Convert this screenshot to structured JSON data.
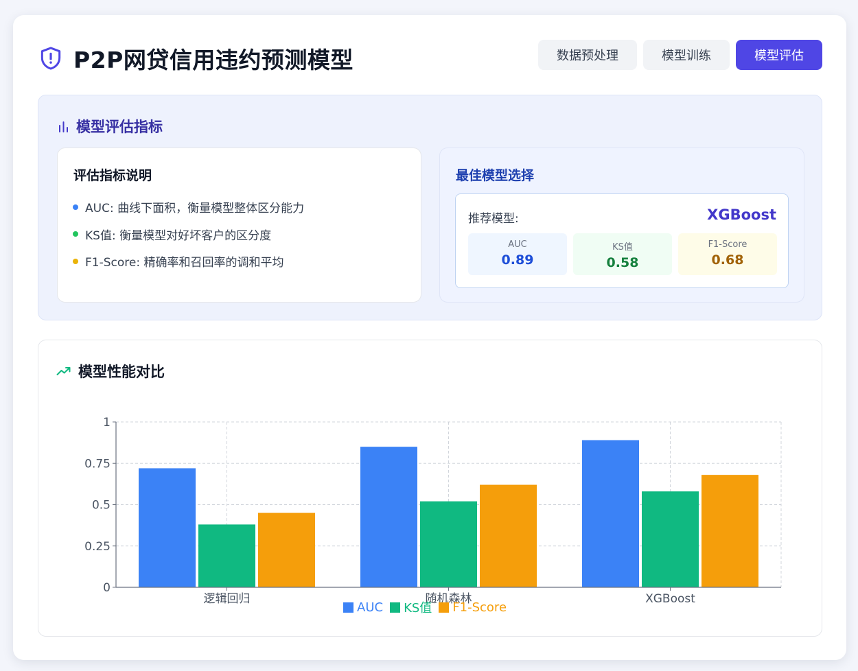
{
  "header": {
    "title": "P2P网贷信用违约预测模型",
    "nav": [
      {
        "label": "数据预处理",
        "active": false
      },
      {
        "label": "模型训练",
        "active": false
      },
      {
        "label": "模型评估",
        "active": true
      }
    ]
  },
  "metrics_section": {
    "title": "模型评估指标",
    "description": {
      "title": "评估指标说明",
      "items": [
        {
          "text": "AUC: 曲线下面积，衡量模型整体区分能力",
          "color": "#3b82f6"
        },
        {
          "text": "KS值: 衡量模型对好坏客户的区分度",
          "color": "#22c55e"
        },
        {
          "text": "F1-Score: 精确率和召回率的调和平均",
          "color": "#eab308"
        }
      ]
    },
    "best_model": {
      "title": "最佳模型选择",
      "recommend_label": "推荐模型:",
      "model_name": "XGBoost",
      "stats": [
        {
          "label": "AUC",
          "value": "0.89",
          "bg": "#eff6ff",
          "color": "#1d4ed8"
        },
        {
          "label": "KS值",
          "value": "0.58",
          "bg": "#f0fdf4",
          "color": "#15803d"
        },
        {
          "label": "F1-Score",
          "value": "0.68",
          "bg": "#fefce8",
          "color": "#a16207"
        }
      ]
    }
  },
  "chart_section": {
    "title": "模型性能对比"
  },
  "chart_data": {
    "type": "bar",
    "categories": [
      "逻辑回归",
      "随机森林",
      "XGBoost"
    ],
    "series": [
      {
        "name": "AUC",
        "values": [
          0.72,
          0.85,
          0.89
        ],
        "color": "#3b82f6"
      },
      {
        "name": "KS值",
        "values": [
          0.38,
          0.52,
          0.58
        ],
        "color": "#10b981"
      },
      {
        "name": "F1-Score",
        "values": [
          0.45,
          0.62,
          0.68
        ],
        "color": "#f59e0b"
      }
    ],
    "yticks": [
      "0",
      "0.25",
      "0.5",
      "0.75",
      "1"
    ],
    "ylim": [
      0,
      1
    ],
    "grid": true,
    "legend": "bottom-center"
  }
}
